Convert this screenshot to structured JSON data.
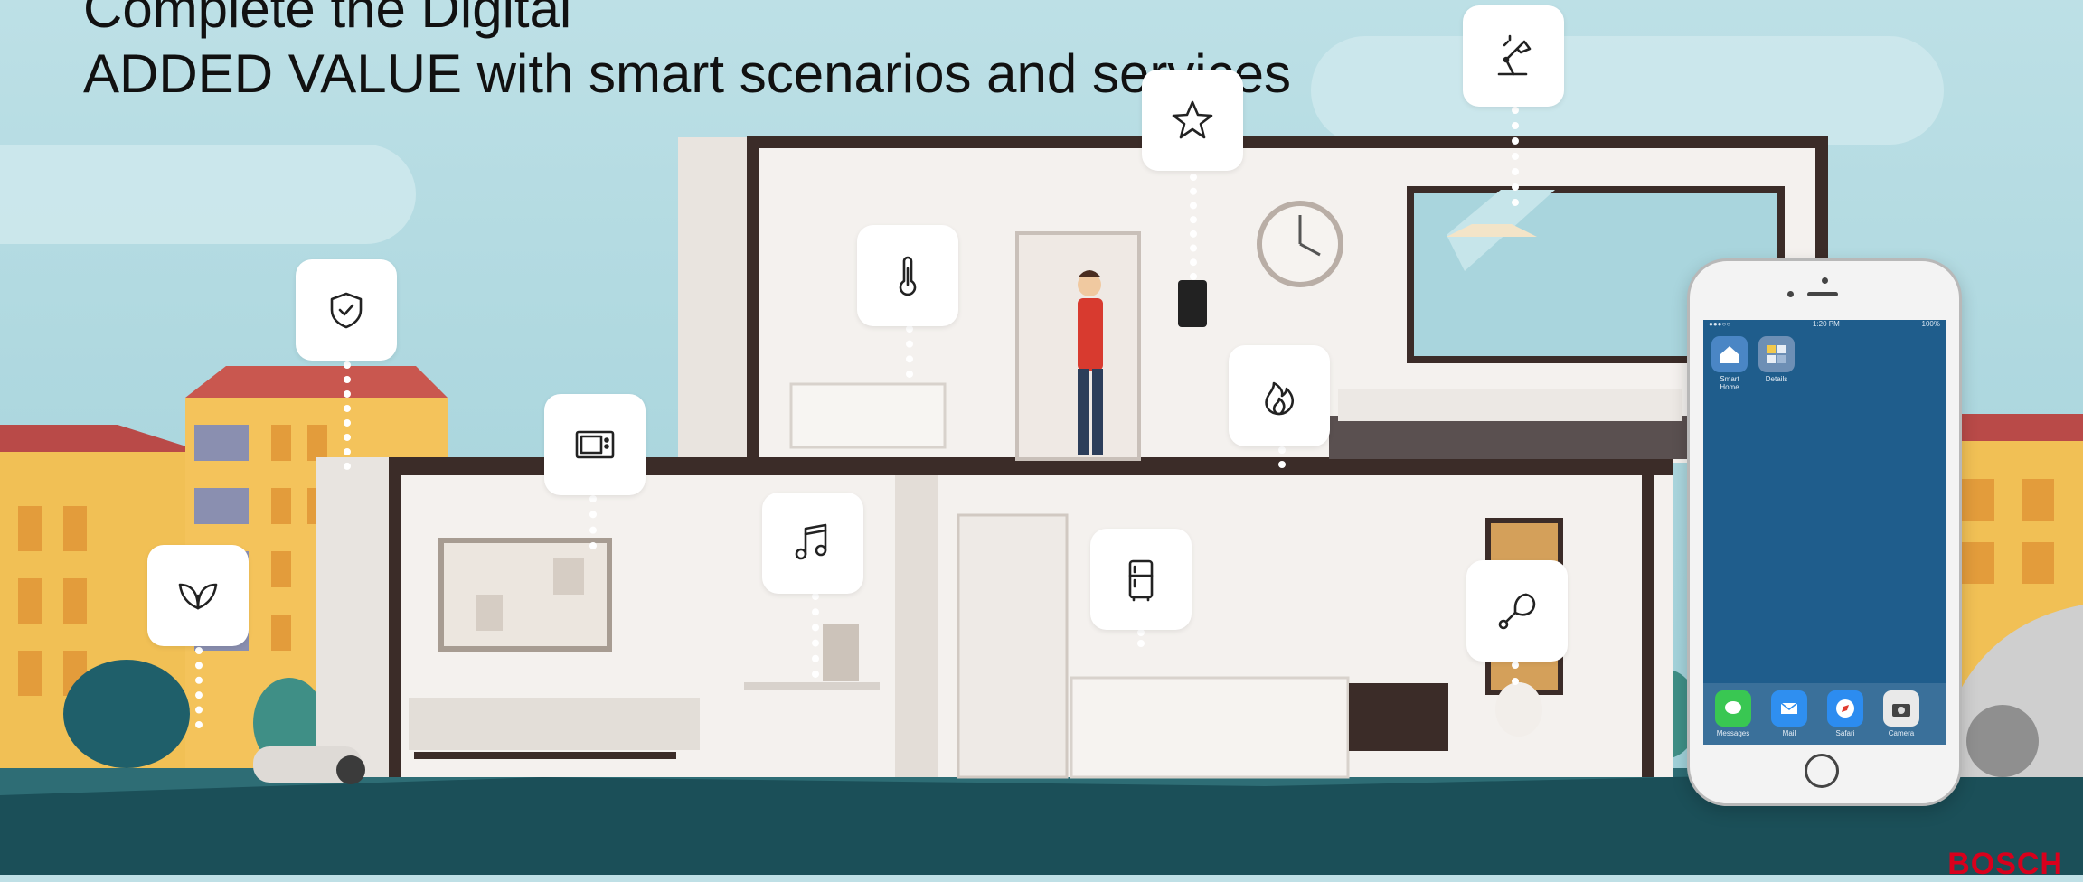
{
  "title": {
    "line1": "Complete the Digital",
    "line2": "ADDED VALUE with smart scenarios and services"
  },
  "icons": [
    {
      "name": "plant-icon"
    },
    {
      "name": "shield-check-icon"
    },
    {
      "name": "tv-icon"
    },
    {
      "name": "music-note-icon"
    },
    {
      "name": "thermometer-icon"
    },
    {
      "name": "star-icon"
    },
    {
      "name": "flame-icon"
    },
    {
      "name": "refrigerator-icon"
    },
    {
      "name": "chicken-leg-icon"
    },
    {
      "name": "desk-lamp-icon"
    }
  ],
  "phone": {
    "status_carrier": "●●●○○ ",
    "status_time": "1:20 PM",
    "status_battery": "100%",
    "apps": [
      {
        "label": "Smart Home",
        "color": "#4a86c5"
      },
      {
        "label": "Details",
        "color": "#6d8fb5"
      }
    ],
    "dock": [
      {
        "label": "Messages",
        "color": "#39c752"
      },
      {
        "label": "Mail",
        "color": "#2f8ff0"
      },
      {
        "label": "Safari",
        "color": "#2c8cf0"
      },
      {
        "label": "Camera",
        "color": "#444444"
      }
    ]
  },
  "brand": {
    "logo_text": "BOSCH",
    "color": "#d8001c"
  }
}
